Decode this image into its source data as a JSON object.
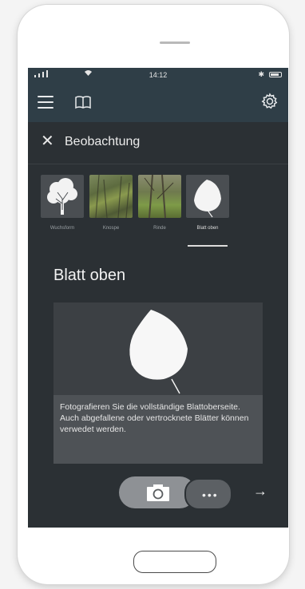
{
  "status_bar": {
    "time": "14:12",
    "bluetooth": "✱"
  },
  "navbar": {
    "menu_icon": "hamburger-icon",
    "book_icon": "book-icon",
    "settings_icon": "gear-icon"
  },
  "header": {
    "close_glyph": "✕",
    "title": "Beobachtung"
  },
  "tabs": [
    {
      "label": "Wuchsform",
      "icon": "tree-silhouette"
    },
    {
      "label": "Knospe",
      "icon": "bud-photo"
    },
    {
      "label": "Rinde",
      "icon": "bark-photo"
    },
    {
      "label": "Blatt oben",
      "icon": "leaf-silhouette",
      "active": true
    }
  ],
  "section": {
    "title": "Blatt oben"
  },
  "card": {
    "image": "leaf-silhouette",
    "instruction": "Fotografieren Sie die vollständige Blattoberseite. Auch abgefallene oder vertrocknete Blätter können verwedet werden."
  },
  "actions": {
    "more_glyph": "•••",
    "next_glyph": "→"
  },
  "colors": {
    "navbar": "#2f3e47",
    "screen_bg": "#2b3034",
    "card_bg": "#3c4044"
  }
}
